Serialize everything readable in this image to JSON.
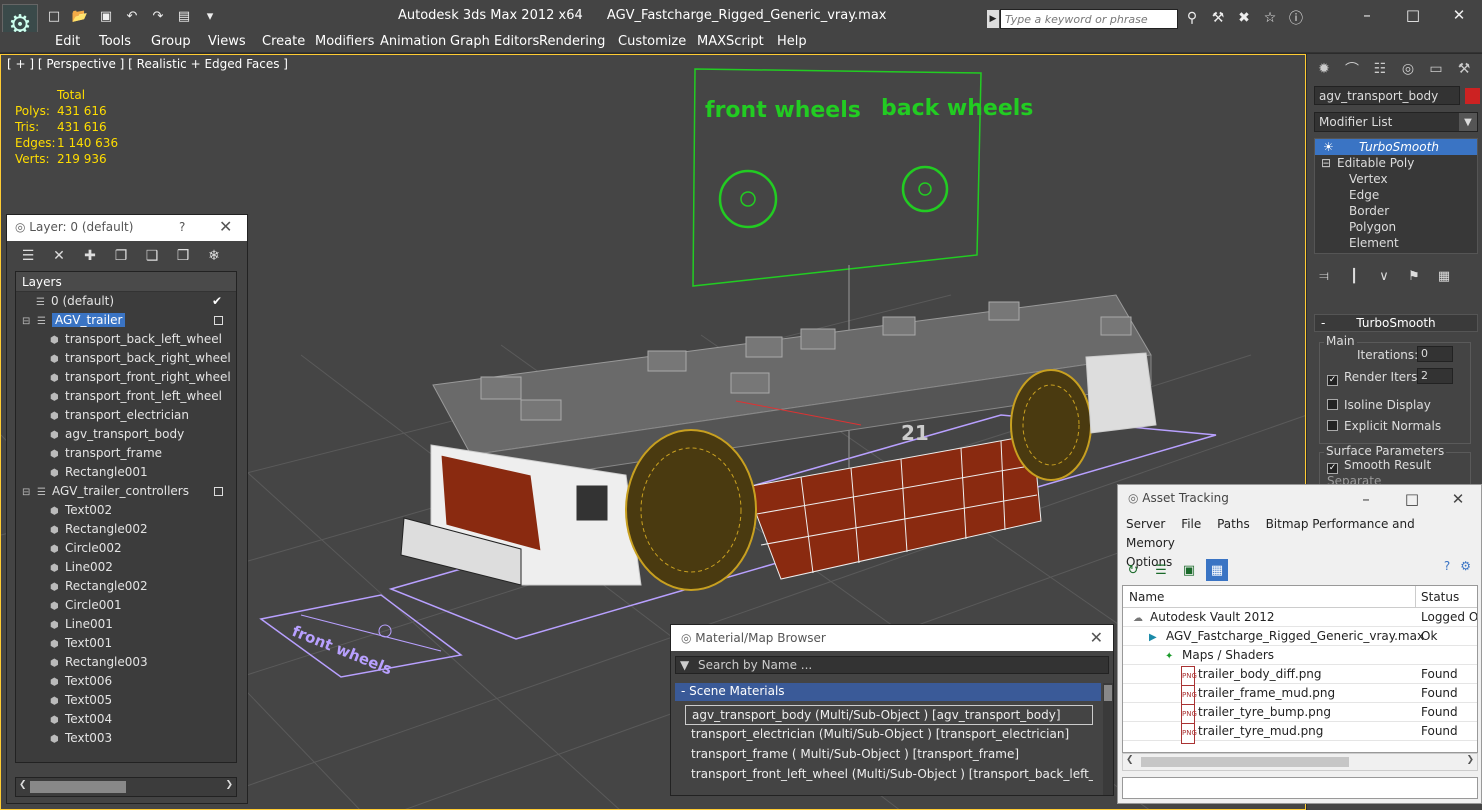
{
  "titlebar": {
    "app": "Autodesk 3ds Max  2012 x64",
    "file": "AGV_Fastcharge_Rigged_Generic_vray.max",
    "search_placeholder": "Type a keyword or phrase"
  },
  "menu": [
    "Edit",
    "Tools",
    "Group",
    "Views",
    "Create",
    "Modifiers",
    "Animation",
    "Graph Editors",
    "Rendering",
    "Customize",
    "MAXScript",
    "Help"
  ],
  "viewport": {
    "label": "[ + ] [ Perspective ] [ Realistic + Edged Faces ]",
    "stats_header": "Total",
    "stats": [
      {
        "label": "Polys:",
        "value": "431 616"
      },
      {
        "label": "Tris:",
        "value": "431 616"
      },
      {
        "label": "Edges:",
        "value": "1 140 636"
      },
      {
        "label": "Verts:",
        "value": "219 936"
      }
    ],
    "scene_text": {
      "front_wheels": "front wheels",
      "back_wheels": "back wheels",
      "number": "21"
    },
    "colors": {
      "grid": "#5a5a5a",
      "wire_green": "#22cc22",
      "tyre": "#c8a020",
      "body": "#8a2a10",
      "helper": "#b8a0ff"
    }
  },
  "command_panel": {
    "object_name": "agv_transport_body",
    "object_color": "#cc2222",
    "modifier_list": "Modifier List",
    "stack": [
      {
        "label": "TurboSmooth",
        "type": "selected"
      },
      {
        "label": "Editable Poly",
        "type": "base"
      },
      {
        "label": "Vertex",
        "type": "sub"
      },
      {
        "label": "Edge",
        "type": "sub"
      },
      {
        "label": "Border",
        "type": "sub"
      },
      {
        "label": "Polygon",
        "type": "sub"
      },
      {
        "label": "Element",
        "type": "sub"
      }
    ],
    "rollout_title": "TurboSmooth",
    "main_group": "Main",
    "iterations_label": "Iterations:",
    "iterations_value": "0",
    "render_iters_label": "Render Iters:",
    "render_iters_value": "2",
    "isoline": "Isoline Display",
    "explicit_normals": "Explicit Normals",
    "surface_group": "Surface Parameters",
    "smooth_result": "Smooth Result",
    "separate": "Separate"
  },
  "layer_panel": {
    "title": "Layer: 0 (default)",
    "help": "?",
    "column": "Layers",
    "rows": [
      {
        "label": "0 (default)",
        "indent": 1,
        "kind": "layer",
        "mark": "check"
      },
      {
        "label": "AGV_trailer",
        "indent": 0,
        "kind": "layer",
        "selected": true,
        "mark": "box"
      },
      {
        "label": "transport_back_left_wheel",
        "indent": 2,
        "kind": "obj"
      },
      {
        "label": "transport_back_right_wheel",
        "indent": 2,
        "kind": "obj"
      },
      {
        "label": "transport_front_right_wheel",
        "indent": 2,
        "kind": "obj"
      },
      {
        "label": "transport_front_left_wheel",
        "indent": 2,
        "kind": "obj"
      },
      {
        "label": "transport_electrician",
        "indent": 2,
        "kind": "obj"
      },
      {
        "label": "agv_transport_body",
        "indent": 2,
        "kind": "obj"
      },
      {
        "label": "transport_frame",
        "indent": 2,
        "kind": "obj"
      },
      {
        "label": "Rectangle001",
        "indent": 2,
        "kind": "obj"
      },
      {
        "label": "AGV_trailer_controllers",
        "indent": 0,
        "kind": "layer",
        "mark": "box"
      },
      {
        "label": "Text002",
        "indent": 2,
        "kind": "obj"
      },
      {
        "label": "Rectangle002",
        "indent": 2,
        "kind": "obj"
      },
      {
        "label": "Circle002",
        "indent": 2,
        "kind": "obj"
      },
      {
        "label": "Line002",
        "indent": 2,
        "kind": "obj"
      },
      {
        "label": "Rectangle002",
        "indent": 2,
        "kind": "obj"
      },
      {
        "label": "Circle001",
        "indent": 2,
        "kind": "obj"
      },
      {
        "label": "Line001",
        "indent": 2,
        "kind": "obj"
      },
      {
        "label": "Text001",
        "indent": 2,
        "kind": "obj"
      },
      {
        "label": "Rectangle003",
        "indent": 2,
        "kind": "obj"
      },
      {
        "label": "Text006",
        "indent": 2,
        "kind": "obj"
      },
      {
        "label": "Text005",
        "indent": 2,
        "kind": "obj"
      },
      {
        "label": "Text004",
        "indent": 2,
        "kind": "obj"
      },
      {
        "label": "Text003",
        "indent": 2,
        "kind": "obj"
      }
    ]
  },
  "material_browser": {
    "title": "Material/Map Browser",
    "search_placeholder": "Search by Name ...",
    "group": "- Scene Materials",
    "rows": [
      "agv_transport_body  (Multi/Sub-Object ) [agv_transport_body]",
      "transport_electrician  (Multi/Sub-Object ) [transport_electrician]",
      "transport_frame  ( Multi/Sub-Object ) [transport_frame]",
      "transport_front_left_wheel  (Multi/Sub-Object ) [transport_back_left_wheel,..."
    ]
  },
  "asset_tracking": {
    "title": "Asset Tracking",
    "menu": [
      "Server",
      "File",
      "Paths",
      "Bitmap Performance and Memory",
      "Options"
    ],
    "columns": {
      "name": "Name",
      "status": "Status"
    },
    "rows": [
      {
        "name": "Autodesk Vault 2012",
        "status": "Logged Ou",
        "indent": 1
      },
      {
        "name": "AGV_Fastcharge_Rigged_Generic_vray.max",
        "status": "Ok",
        "indent": 2
      },
      {
        "name": "Maps / Shaders",
        "status": "",
        "indent": 3
      },
      {
        "name": "trailer_body_diff.png",
        "status": "Found",
        "indent": 4
      },
      {
        "name": "trailer_frame_mud.png",
        "status": "Found",
        "indent": 4
      },
      {
        "name": "trailer_tyre_bump.png",
        "status": "Found",
        "indent": 4
      },
      {
        "name": "trailer_tyre_mud.png",
        "status": "Found",
        "indent": 4
      }
    ]
  }
}
